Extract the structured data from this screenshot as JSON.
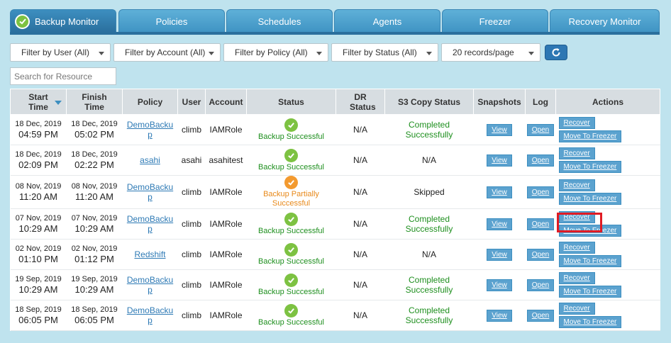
{
  "tabs": [
    {
      "label": "Backup Monitor",
      "active": true
    },
    {
      "label": "Policies"
    },
    {
      "label": "Schedules"
    },
    {
      "label": "Agents"
    },
    {
      "label": "Freezer"
    },
    {
      "label": "Recovery Monitor"
    }
  ],
  "filters": {
    "user": "Filter by User (All)",
    "account": "Filter by Account (All)",
    "policy": "Filter by Policy (All)",
    "status": "Filter by Status (All)",
    "page_size": "20 records/page"
  },
  "search": {
    "placeholder": "Search for Resource"
  },
  "table": {
    "headers": {
      "start": "Start Time",
      "finish": "Finish Time",
      "policy": "Policy",
      "user": "User",
      "account": "Account",
      "status": "Status",
      "dr": "DR Status",
      "s3": "S3 Copy Status",
      "snapshots": "Snapshots",
      "log": "Log",
      "actions": "Actions"
    },
    "rows": [
      {
        "start_d": "18 Dec, 2019",
        "start_t": "04:59 PM",
        "fin_d": "18 Dec, 2019",
        "fin_t": "05:02 PM",
        "policy": "DemoBackup",
        "user": "climb",
        "account": "IAMRole",
        "status": "Backup Successful",
        "state": "ok",
        "dr": "N/A",
        "s3": "Completed Successfully"
      },
      {
        "start_d": "18 Dec, 2019",
        "start_t": "02:09 PM",
        "fin_d": "18 Dec, 2019",
        "fin_t": "02:22 PM",
        "policy": "asahi",
        "user": "asahi",
        "account": "asahitest",
        "status": "Backup Successful",
        "state": "ok",
        "dr": "N/A",
        "s3": "N/A"
      },
      {
        "start_d": "08 Nov, 2019",
        "start_t": "11:20 AM",
        "fin_d": "08 Nov, 2019",
        "fin_t": "11:20 AM",
        "policy": "DemoBackup",
        "user": "climb",
        "account": "IAMRole",
        "status": "Backup Partially Successful",
        "state": "warn",
        "dr": "N/A",
        "s3": "Skipped"
      },
      {
        "start_d": "07 Nov, 2019",
        "start_t": "10:29 AM",
        "fin_d": "07 Nov, 2019",
        "fin_t": "10:29 AM",
        "policy": "DemoBackup",
        "user": "climb",
        "account": "IAMRole",
        "status": "Backup Successful",
        "state": "ok",
        "dr": "N/A",
        "s3": "Completed Successfully"
      },
      {
        "start_d": "02 Nov, 2019",
        "start_t": "01:10 PM",
        "fin_d": "02 Nov, 2019",
        "fin_t": "01:12 PM",
        "policy": "Redshift",
        "user": "climb",
        "account": "IAMRole",
        "status": "Backup Successful",
        "state": "ok",
        "dr": "N/A",
        "s3": "N/A"
      },
      {
        "start_d": "19 Sep, 2019",
        "start_t": "10:29 AM",
        "fin_d": "19 Sep, 2019",
        "fin_t": "10:29 AM",
        "policy": "DemoBackup",
        "user": "climb",
        "account": "IAMRole",
        "status": "Backup Successful",
        "state": "ok",
        "dr": "N/A",
        "s3": "Completed Successfully"
      },
      {
        "start_d": "18 Sep, 2019",
        "start_t": "06:05 PM",
        "fin_d": "18 Sep, 2019",
        "fin_t": "06:05 PM",
        "policy": "DemoBackup",
        "user": "climb",
        "account": "IAMRole",
        "status": "Backup Successful",
        "state": "ok",
        "dr": "N/A",
        "s3": "Completed Successfully"
      }
    ],
    "view_label": "View",
    "open_label": "Open",
    "recover_label": "Recover",
    "freezer_label": "Move To Freezer"
  },
  "colors": {
    "tab": "#3f93c3",
    "success": "#7dc242",
    "partial": "#f39a2f",
    "highlight": "#e01b24"
  }
}
